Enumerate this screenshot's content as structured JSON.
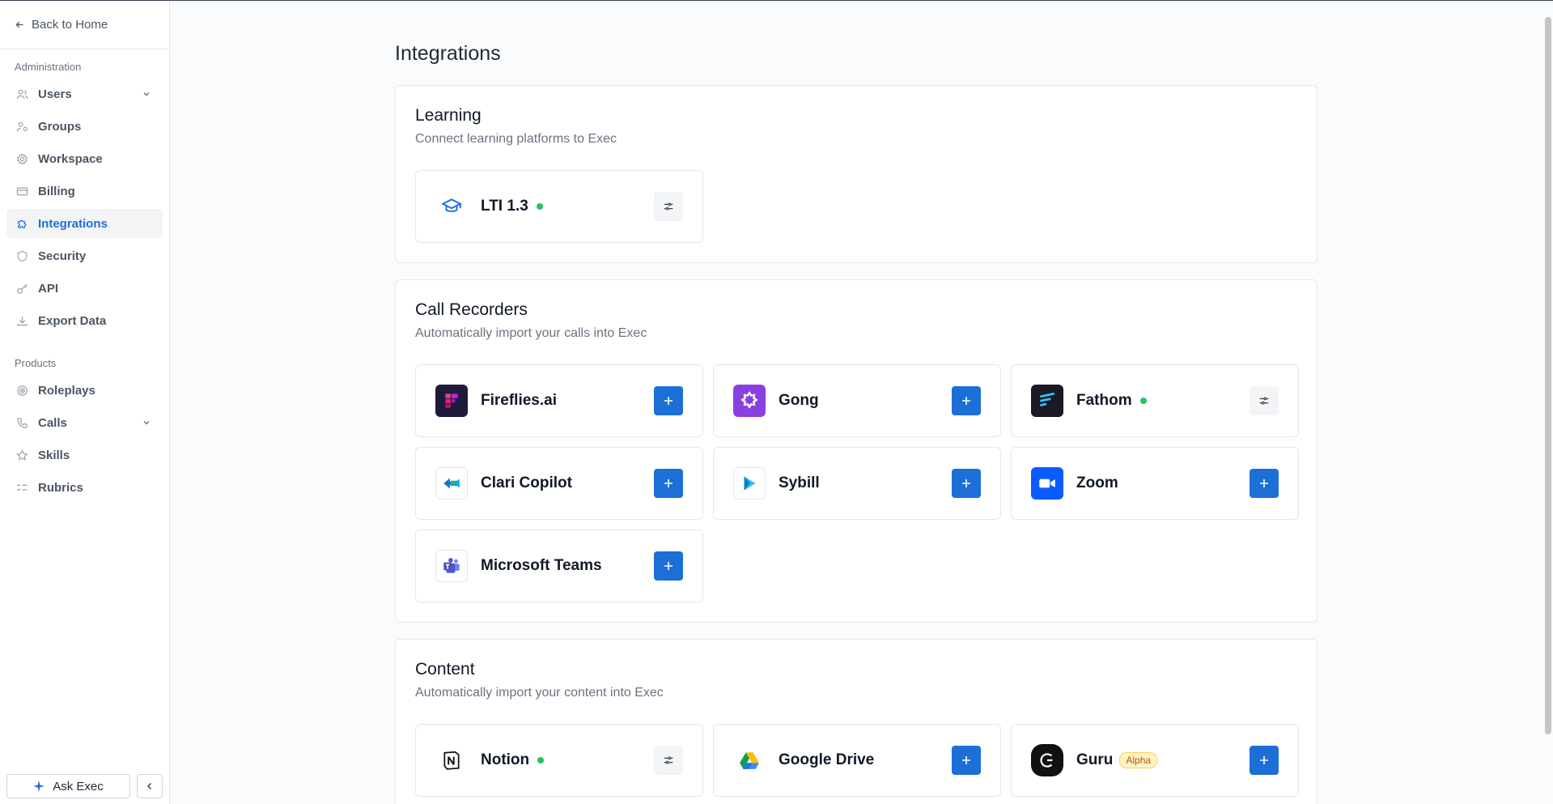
{
  "sidebar": {
    "back_label": "Back to Home",
    "admin_label": "Administration",
    "admin_items": [
      {
        "label": "Users"
      },
      {
        "label": "Groups"
      },
      {
        "label": "Workspace"
      },
      {
        "label": "Billing"
      },
      {
        "label": "Integrations",
        "active": true
      },
      {
        "label": "Security"
      },
      {
        "label": "API"
      },
      {
        "label": "Export Data"
      }
    ],
    "products_label": "Products",
    "product_items": [
      {
        "label": "Roleplays"
      },
      {
        "label": "Calls"
      },
      {
        "label": "Skills"
      },
      {
        "label": "Rubrics"
      }
    ],
    "ask_label": "Ask Exec"
  },
  "main": {
    "title": "Integrations",
    "sections": [
      {
        "title": "Learning",
        "subtitle": "Connect learning platforms to Exec",
        "items": [
          {
            "name": "LTI 1.3",
            "connected": true,
            "icon": "graduation-cap-icon"
          }
        ]
      },
      {
        "title": "Call Recorders",
        "subtitle": "Automatically import your calls into Exec",
        "items": [
          {
            "name": "Fireflies.ai",
            "connected": false,
            "icon": "fireflies-logo"
          },
          {
            "name": "Gong",
            "connected": false,
            "icon": "gong-logo"
          },
          {
            "name": "Fathom",
            "connected": true,
            "icon": "fathom-logo"
          },
          {
            "name": "Clari Copilot",
            "connected": false,
            "icon": "clari-logo"
          },
          {
            "name": "Sybill",
            "connected": false,
            "icon": "sybill-logo"
          },
          {
            "name": "Zoom",
            "connected": false,
            "icon": "zoom-logo"
          },
          {
            "name": "Microsoft Teams",
            "connected": false,
            "icon": "teams-logo"
          }
        ]
      },
      {
        "title": "Content",
        "subtitle": "Automatically import your content into Exec",
        "items": [
          {
            "name": "Notion",
            "connected": true,
            "icon": "notion-logo"
          },
          {
            "name": "Google Drive",
            "connected": false,
            "icon": "google-drive-logo"
          },
          {
            "name": "Guru",
            "connected": false,
            "badge": "Alpha",
            "icon": "guru-logo"
          }
        ]
      }
    ]
  },
  "colors": {
    "accent": "#1d6fd8",
    "connected_dot": "#22c55e"
  }
}
